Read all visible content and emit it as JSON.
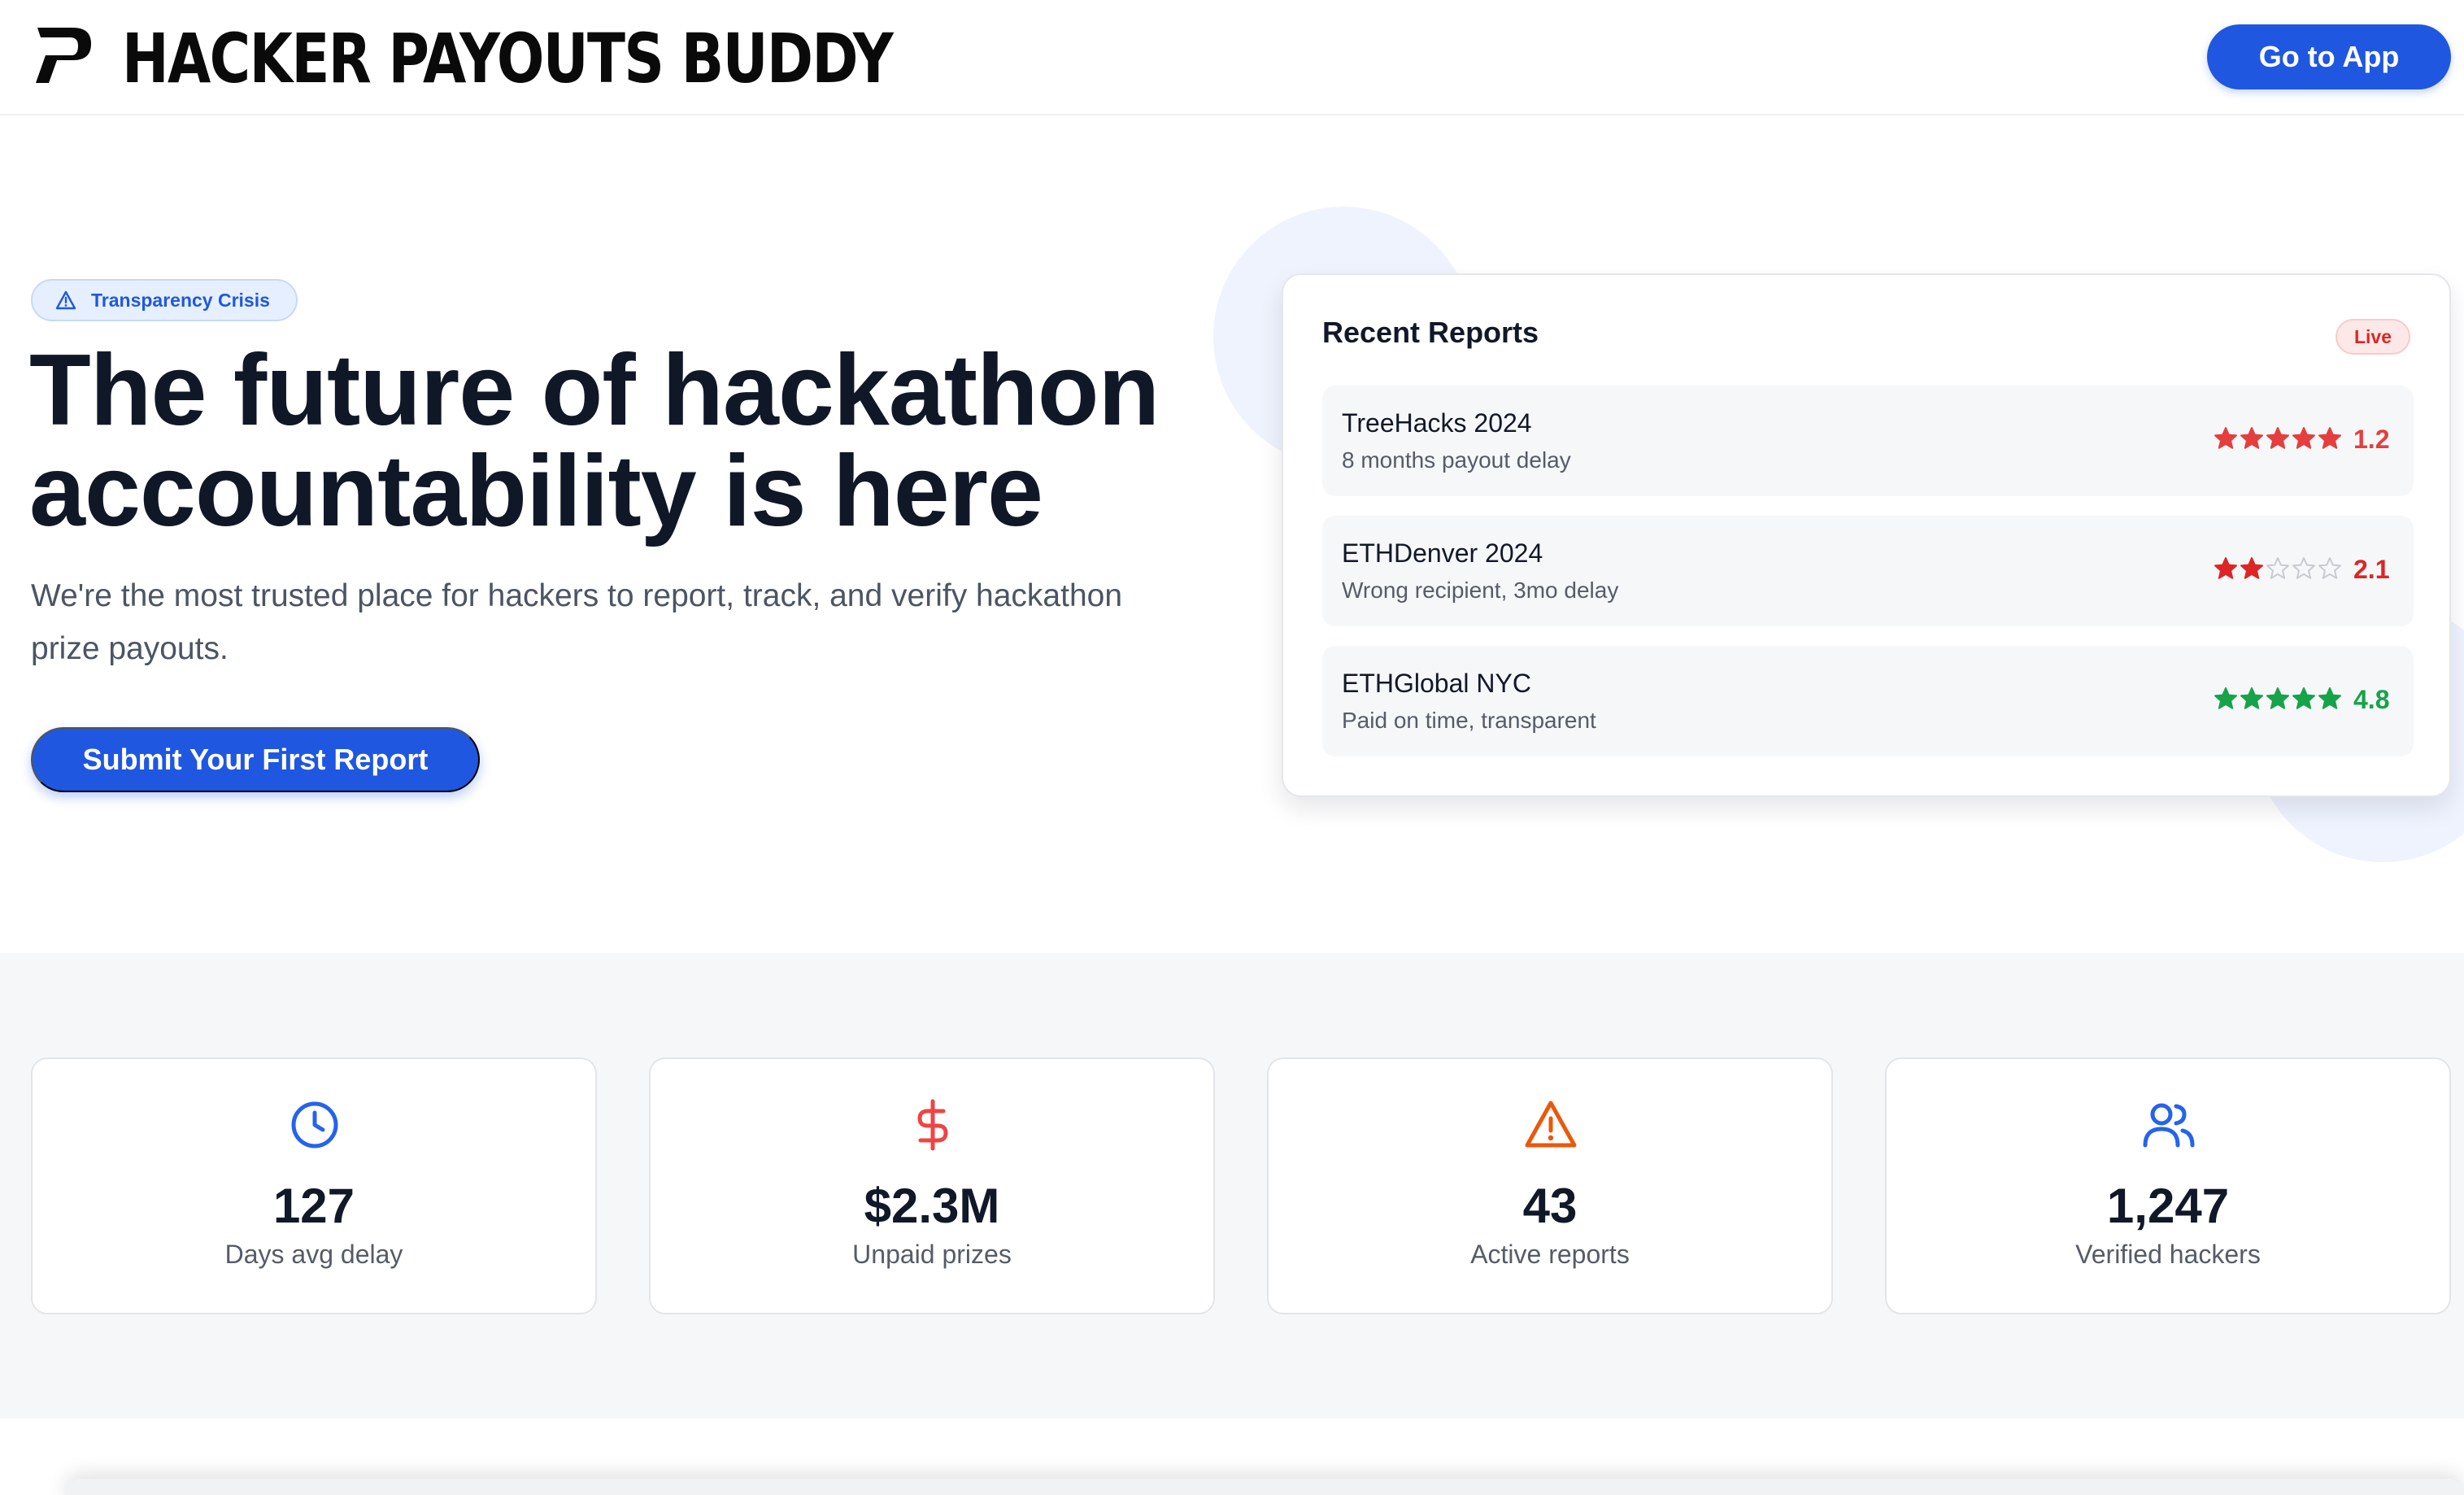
{
  "nav": {
    "brand": "HACKER PAYOUTS BUDDY",
    "cta_label": "Go to App"
  },
  "hero": {
    "badge": "Transparency Crisis",
    "title_line1": "The future of hackathon",
    "title_line2": "accountability is here",
    "subtitle": "We're the most trusted place for hackers to report, track, and verify hackathon prize payouts.",
    "cta_label": "Submit Your First Report"
  },
  "recent_reports": {
    "title": "Recent Reports",
    "live_label": "Live",
    "items": [
      {
        "name": "TreeHacks 2024",
        "desc": "8 months payout delay",
        "score": "1.2",
        "stars_filled": 5,
        "color": "#e53e3e"
      },
      {
        "name": "ETHDenver 2024",
        "desc": "Wrong recipient, 3mo delay",
        "score": "2.1",
        "stars_filled": 2,
        "color": "#dc2626"
      },
      {
        "name": "ETHGlobal NYC",
        "desc": "Paid on time, transparent",
        "score": "4.8",
        "stars_filled": 5,
        "color": "#16a34a"
      }
    ]
  },
  "stats": [
    {
      "icon": "clock-icon",
      "value": "127",
      "label": "Days avg delay",
      "color": "#2563eb"
    },
    {
      "icon": "dollar-icon",
      "value": "$2.3M",
      "label": "Unpaid prizes",
      "color": "#ef4444"
    },
    {
      "icon": "warning-icon",
      "value": "43",
      "label": "Active reports",
      "color": "#ea580c"
    },
    {
      "icon": "users-icon",
      "value": "1,247",
      "label": "Verified hackers",
      "color": "#2563eb"
    }
  ],
  "colors": {
    "primary": "#1f57e0",
    "heading": "#101828",
    "muted": "#4b5563"
  }
}
